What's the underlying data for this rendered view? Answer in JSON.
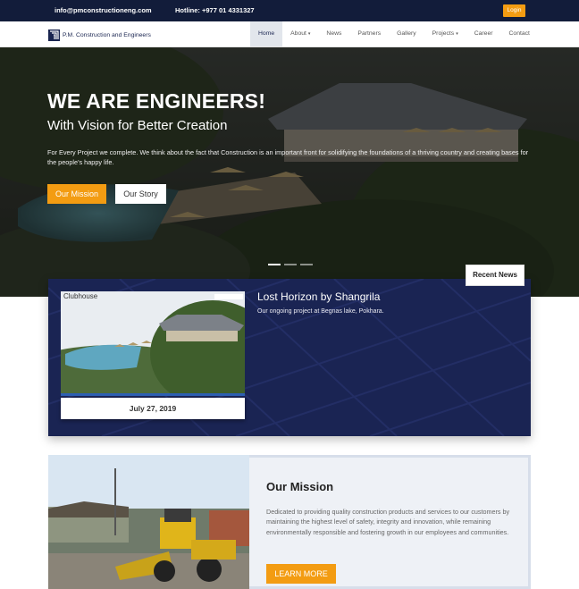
{
  "topbar": {
    "email": "info@pmconstructioneng.com",
    "hotline": "Hotline: +977 01 4331327",
    "login_label": "Login"
  },
  "navbar": {
    "brand": "P.M. Construction and Engineers",
    "links": [
      {
        "label": "Home",
        "active": true
      },
      {
        "label": "About",
        "dropdown": true
      },
      {
        "label": "News"
      },
      {
        "label": "Partners"
      },
      {
        "label": "Gallery"
      },
      {
        "label": "Projects",
        "dropdown": true
      },
      {
        "label": "Career"
      },
      {
        "label": "Contact"
      }
    ],
    "caret": "▾"
  },
  "hero": {
    "heading": "WE ARE ENGINEERS!",
    "subheading": "With Vision for Better Creation",
    "paragraph": "For Every Project we complete. We think about the fact that Construction is an important front for solidifying the foundations of a thriving country and creating bases for the people's happy life.",
    "primary_button": "Our Mission",
    "secondary_button": "Our Story",
    "slides": 3,
    "active_slide": 1
  },
  "news": {
    "tab_label": "Recent News",
    "image_caption": "Clubhouse",
    "date": "July 27, 2019",
    "title": "Lost Horizon by Shangrila",
    "description": "Our ongoing project at Begnas lake, Pokhara."
  },
  "mission": {
    "title": "Our Mission",
    "text": "Dedicated to providing quality construction products and services to our customers by maintaining the highest level of safety, integrity and innovation, while remaining environmentally responsible and fostering growth in our employees and communities.",
    "button": "LEARN MORE"
  },
  "colors": {
    "navy": "#121c3a",
    "accent_orange": "#f39c12",
    "card_navy": "#1a2453"
  },
  "icons": [
    "brand-logo-icon",
    "caret-down-icon"
  ]
}
